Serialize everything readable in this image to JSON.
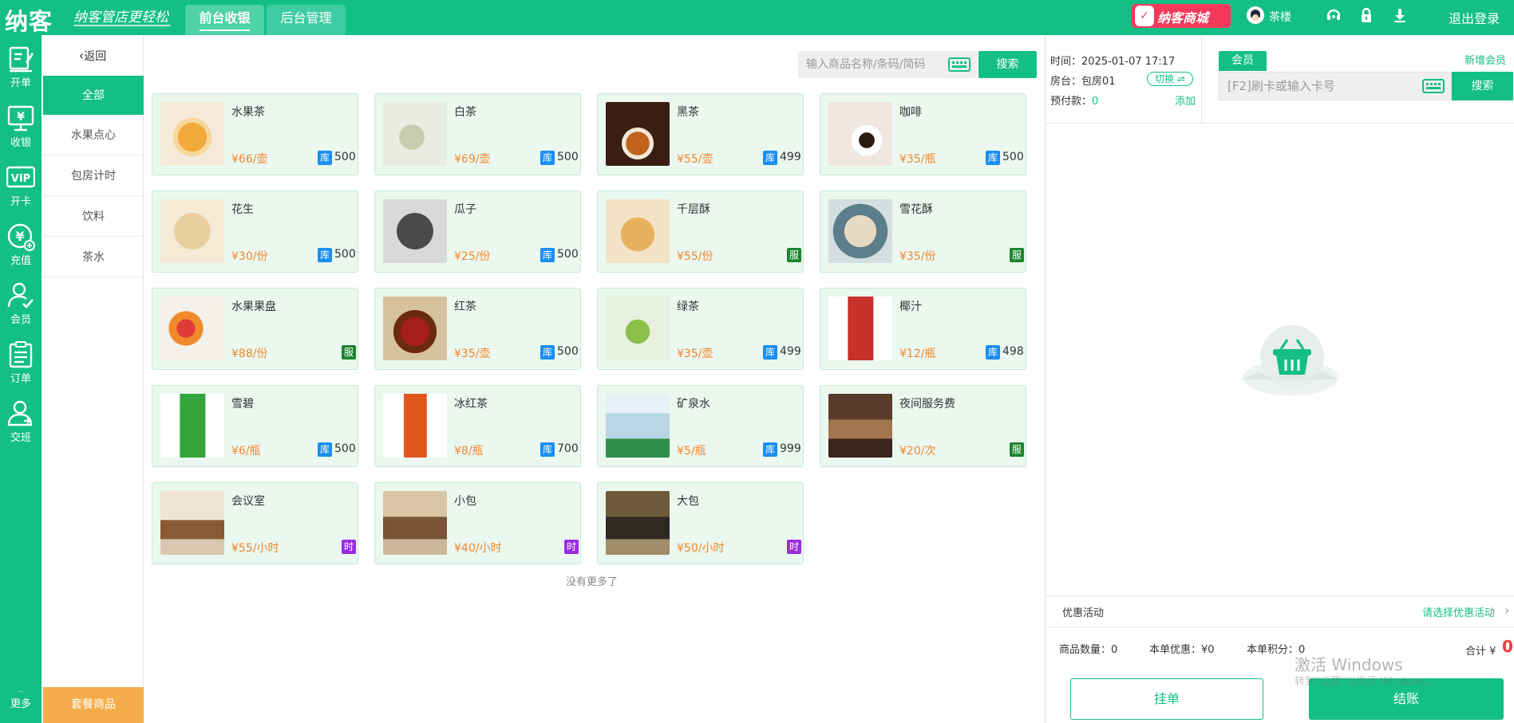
{
  "brand": {
    "logo": "纳客",
    "slogan": "纳客管店更轻松"
  },
  "top_tabs": [
    {
      "label": "前台收银",
      "active": true
    },
    {
      "label": "后台管理",
      "active": false
    }
  ],
  "topbar": {
    "mall_label": "纳客商城",
    "user_name": "茶楼",
    "logout_label": "退出登录",
    "icons": [
      "headset-icon",
      "lock-icon",
      "download-icon"
    ]
  },
  "left_nav": [
    {
      "label": "开单",
      "icon": "edit-order-icon"
    },
    {
      "label": "收银",
      "icon": "cashier-monitor-icon"
    },
    {
      "label": "开卡",
      "icon": "vip-card-icon"
    },
    {
      "label": "充值",
      "icon": "yen-recharge-icon"
    },
    {
      "label": "会员",
      "icon": "member-check-icon"
    },
    {
      "label": "订单",
      "icon": "order-list-icon"
    },
    {
      "label": "交班",
      "icon": "shift-handover-icon"
    }
  ],
  "left_nav_more": "更多",
  "categories": {
    "back_label": "返回",
    "items": [
      {
        "label": "全部",
        "active": true
      },
      {
        "label": "水果点心",
        "active": false
      },
      {
        "label": "包房计时",
        "active": false
      },
      {
        "label": "饮料",
        "active": false
      },
      {
        "label": "茶水",
        "active": false
      }
    ],
    "combo_label": "套餐商品"
  },
  "search": {
    "placeholder": "输入商品名称/条码/简码",
    "value": "",
    "button_label": "搜索"
  },
  "products": [
    {
      "name": "水果茶",
      "price": "¥66/壶",
      "badge": "库",
      "badge_type": "ku",
      "stock": "500",
      "image": "fruit-tea-pot"
    },
    {
      "name": "白茶",
      "price": "¥69/壶",
      "badge": "库",
      "badge_type": "ku",
      "stock": "500",
      "image": "white-tea-leaves"
    },
    {
      "name": "黑茶",
      "price": "¥55/壶",
      "badge": "库",
      "badge_type": "ku",
      "stock": "499",
      "image": "dark-tea-cup"
    },
    {
      "name": "咖啡",
      "price": "¥35/瓶",
      "badge": "库",
      "badge_type": "ku",
      "stock": "500",
      "image": "coffee-cup"
    },
    {
      "name": "花生",
      "price": "¥30/份",
      "badge": "库",
      "badge_type": "ku",
      "stock": "500",
      "image": "peanuts"
    },
    {
      "name": "瓜子",
      "price": "¥25/份",
      "badge": "库",
      "badge_type": "ku",
      "stock": "500",
      "image": "sunflower-seeds"
    },
    {
      "name": "千层酥",
      "price": "¥55/份",
      "badge": "服",
      "badge_type": "fu",
      "stock": "",
      "image": "puff-pastry"
    },
    {
      "name": "雪花酥",
      "price": "¥35/份",
      "badge": "服",
      "badge_type": "fu",
      "stock": "",
      "image": "snowflake-crisp"
    },
    {
      "name": "水果果盘",
      "price": "¥88/份",
      "badge": "服",
      "badge_type": "fu",
      "stock": "",
      "image": "fruit-platter"
    },
    {
      "name": "红茶",
      "price": "¥35/壶",
      "badge": "库",
      "badge_type": "ku",
      "stock": "500",
      "image": "black-tea-pot"
    },
    {
      "name": "绿茶",
      "price": "¥35/壶",
      "badge": "库",
      "badge_type": "ku",
      "stock": "499",
      "image": "green-tea-glass"
    },
    {
      "name": "椰汁",
      "price": "¥12/瓶",
      "badge": "库",
      "badge_type": "ku",
      "stock": "498",
      "image": "coconut-juice-can"
    },
    {
      "name": "雪碧",
      "price": "¥6/瓶",
      "badge": "库",
      "badge_type": "ku",
      "stock": "500",
      "image": "sprite-bottle"
    },
    {
      "name": "冰红茶",
      "price": "¥8/瓶",
      "badge": "库",
      "badge_type": "ku",
      "stock": "700",
      "image": "iced-tea-bottle"
    },
    {
      "name": "矿泉水",
      "price": "¥5/瓶",
      "badge": "库",
      "badge_type": "ku",
      "stock": "999",
      "image": "water-bottles"
    },
    {
      "name": "夜间服务费",
      "price": "¥20/次",
      "badge": "服",
      "badge_type": "fu",
      "stock": "",
      "image": "night-room"
    },
    {
      "name": "会议室",
      "price": "¥55/小时",
      "badge": "时",
      "badge_type": "shi",
      "stock": "",
      "image": "meeting-room"
    },
    {
      "name": "小包",
      "price": "¥40/小时",
      "badge": "时",
      "badge_type": "shi",
      "stock": "",
      "image": "small-room"
    },
    {
      "name": "大包",
      "price": "¥50/小时",
      "badge": "时",
      "badge_type": "shi",
      "stock": "",
      "image": "large-room"
    }
  ],
  "no_more": "没有更多了",
  "order_info": {
    "time_label": "时间：",
    "time_value": "2025-01-07 17:17",
    "room_label": "房台：",
    "room_value": "包房01",
    "switch_label": "切换 ⇌",
    "prepay_label": "预付款：",
    "prepay_value": "0",
    "add_label": "添加"
  },
  "member": {
    "tab_label": "会员",
    "new_member_label": "新增会员",
    "card_placeholder": "[F2]刷卡或输入卡号",
    "card_value": "",
    "search_label": "搜索"
  },
  "promo": {
    "label": "优惠活动",
    "select_label": "请选择优惠活动"
  },
  "summary": {
    "qty_label": "商品数量：",
    "qty_value": "0",
    "discount_label": "本单优惠：",
    "discount_value": "¥0",
    "points_label": "本单积分：",
    "points_value": "0",
    "total_label": "合计 ¥",
    "total_value": "0"
  },
  "actions": {
    "hang_label": "挂单",
    "pay_label": "结账"
  },
  "watermark": {
    "line1": "激活 Windows",
    "line2": "转到\"设置\"以激活 Windows。"
  },
  "colors": {
    "brand_green": "#13bf86",
    "price_orange": "#f5852a",
    "stock_badge": "#1a8ef2",
    "service_badge": "#19862b",
    "time_badge": "#9b2de0",
    "mall_red": "#f4385a",
    "combo_orange": "#f5ad4b",
    "total_red": "#f43a3a"
  }
}
